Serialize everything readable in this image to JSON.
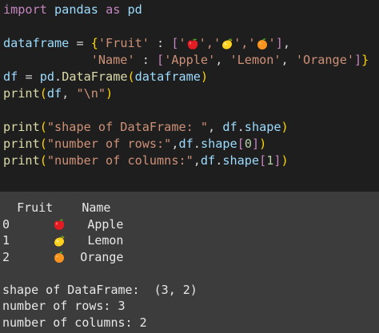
{
  "code": {
    "line1": {
      "kw_import": "import",
      "mod": "pandas",
      "kw_as": "as",
      "alias": "pd"
    },
    "line2": {
      "var": "dataframe",
      "eq": " = ",
      "brace_open": "{",
      "key": "'Fruit'",
      "colon": " : ",
      "list_open": "[",
      "q1": "'",
      "q2": "','",
      "q3": "','",
      "q4": "'",
      "list_close": "]",
      "comma": ","
    },
    "line3": {
      "indent": "            ",
      "key": "'Name'",
      "colon": " : ",
      "list_open": "[",
      "v1": "'Apple'",
      "sep1": ", ",
      "v2": "'Lemon'",
      "sep2": ", ",
      "v3": "'Orange'",
      "list_close": "]",
      "brace_close": "}"
    },
    "line4": {
      "var": "df",
      "eq": " = ",
      "obj": "pd",
      "dot": ".",
      "fn": "DataFrame",
      "paren_open": "(",
      "arg": "dataframe",
      "paren_close": ")"
    },
    "line5": {
      "fn": "print",
      "paren_open": "(",
      "arg": "df",
      "comma": ", ",
      "str": "\"\\n\"",
      "paren_close": ")"
    },
    "line6": {
      "fn": "print",
      "paren_open": "(",
      "str": "\"shape of DataFrame: \"",
      "comma": ", ",
      "obj": "df",
      "dot": ".",
      "attr": "shape",
      "paren_close": ")"
    },
    "line7": {
      "fn": "print",
      "paren_open": "(",
      "str": "\"number of rows:\"",
      "comma": ",",
      "obj": "df",
      "dot": ".",
      "attr": "shape",
      "bracket_open": "[",
      "idx": "0",
      "bracket_close": "]",
      "paren_close": ")"
    },
    "line8": {
      "fn": "print",
      "paren_open": "(",
      "str": "\"number of columns:\"",
      "comma": ",",
      "obj": "df",
      "dot": ".",
      "attr": "shape",
      "bracket_open": "[",
      "idx": "1",
      "bracket_close": "]",
      "paren_close": ")"
    }
  },
  "output": {
    "header": {
      "fruit": "Fruit",
      "name": "Name"
    },
    "rows": [
      {
        "index": "0",
        "fruit_icon": "apple-emoji",
        "name": "Apple"
      },
      {
        "index": "1",
        "fruit_icon": "lemon-emoji",
        "name": "Lemon"
      },
      {
        "index": "2",
        "fruit_icon": "orange-emoji",
        "name": "Orange"
      }
    ],
    "shape_line": "shape of DataFrame:  (3, 2)",
    "rows_line": "number of rows: 3",
    "columns_line": "number of columns: 2"
  },
  "colors": {
    "code_background": "#1e1e1e",
    "output_background": "#3c3c3c",
    "keyword": "#c586c0",
    "identifier": "#9cdcfe",
    "function": "#dcdcaa",
    "string": "#ce9178",
    "number": "#b5cea8",
    "bracket": "#ffd700"
  }
}
